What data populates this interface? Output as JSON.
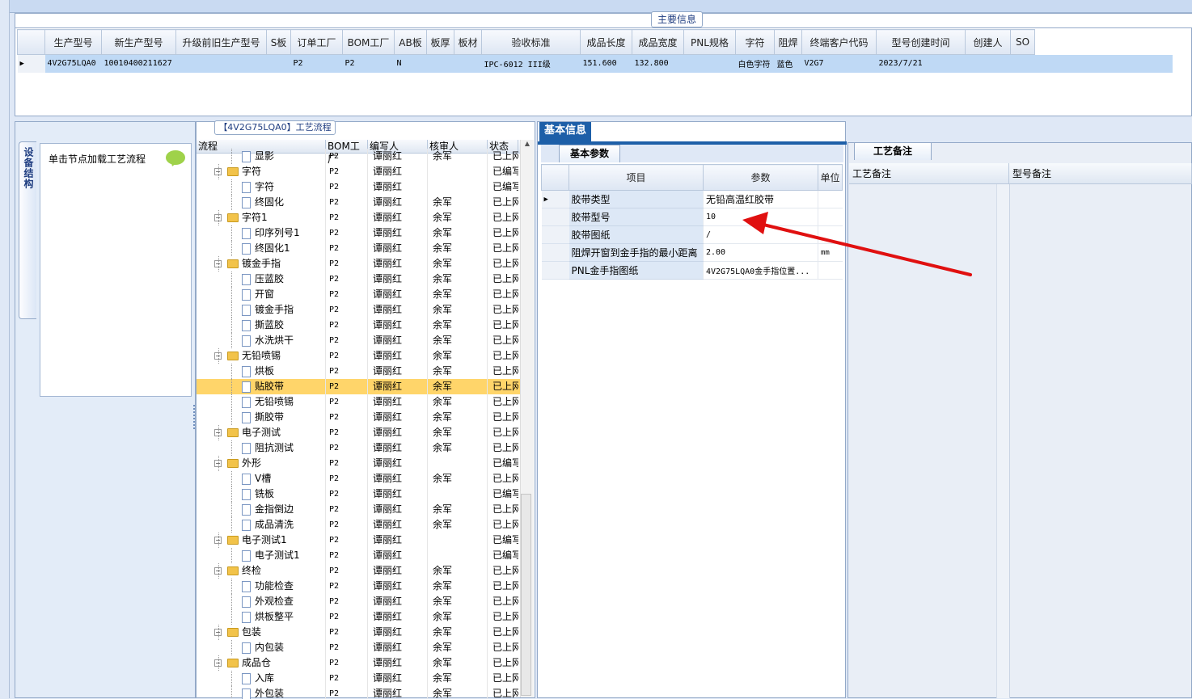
{
  "main_info": {
    "tab_label": "主要信息",
    "columns": [
      "生产型号",
      "新生产型号",
      "升级前旧生产型号",
      "S板",
      "订单工厂",
      "BOM工厂",
      "AB板",
      "板厚",
      "板材",
      "验收标准",
      "成品长度",
      "成品宽度",
      "PNL规格",
      "字符",
      "阻焊",
      "终端客户代码",
      "型号创建时间",
      "创建人",
      "SO"
    ],
    "row": [
      "4V2G75LQA0",
      "10010400211627",
      "",
      "",
      "P2",
      "P2",
      "N",
      "",
      "",
      "IPC-6012 III级",
      "151.600",
      "132.800",
      "",
      "白色字符",
      "蓝色",
      "V2G7",
      "2023/7/21",
      "",
      ""
    ]
  },
  "left_panel": {
    "vertical_tab": "设备结构",
    "box_title": "单击节点加载工艺流程",
    "bubble_icon": "speech-bubble-icon"
  },
  "tree_panel": {
    "tab_label": "【4V2G75LQA0】工艺流程",
    "headers": [
      "流程",
      "BOM工厂",
      "编写人",
      "核审人",
      "状态"
    ],
    "rows": [
      {
        "level": 1,
        "type": "doc",
        "name": "显影",
        "bom": "P2",
        "author": "谭丽红",
        "reviewer": "余军",
        "status": "已上网"
      },
      {
        "level": 0,
        "type": "folder",
        "name": "字符",
        "bom": "P2",
        "author": "谭丽红",
        "reviewer": "",
        "status": "已编写"
      },
      {
        "level": 1,
        "type": "doc",
        "name": "字符",
        "bom": "P2",
        "author": "谭丽红",
        "reviewer": "",
        "status": "已编写"
      },
      {
        "level": 1,
        "type": "doc",
        "name": "终固化",
        "bom": "P2",
        "author": "谭丽红",
        "reviewer": "余军",
        "status": "已上网"
      },
      {
        "level": 0,
        "type": "folder",
        "name": "字符1",
        "bom": "P2",
        "author": "谭丽红",
        "reviewer": "余军",
        "status": "已上网"
      },
      {
        "level": 1,
        "type": "doc",
        "name": "印序列号1",
        "bom": "P2",
        "author": "谭丽红",
        "reviewer": "余军",
        "status": "已上网"
      },
      {
        "level": 1,
        "type": "doc",
        "name": "终固化1",
        "bom": "P2",
        "author": "谭丽红",
        "reviewer": "余军",
        "status": "已上网"
      },
      {
        "level": 0,
        "type": "folder",
        "name": "镀金手指",
        "bom": "P2",
        "author": "谭丽红",
        "reviewer": "余军",
        "status": "已上网"
      },
      {
        "level": 1,
        "type": "doc",
        "name": "压蓝胶",
        "bom": "P2",
        "author": "谭丽红",
        "reviewer": "余军",
        "status": "已上网"
      },
      {
        "level": 1,
        "type": "doc",
        "name": "开窗",
        "bom": "P2",
        "author": "谭丽红",
        "reviewer": "余军",
        "status": "已上网"
      },
      {
        "level": 1,
        "type": "doc",
        "name": "镀金手指",
        "bom": "P2",
        "author": "谭丽红",
        "reviewer": "余军",
        "status": "已上网"
      },
      {
        "level": 1,
        "type": "doc",
        "name": "撕蓝胶",
        "bom": "P2",
        "author": "谭丽红",
        "reviewer": "余军",
        "status": "已上网"
      },
      {
        "level": 1,
        "type": "doc",
        "name": "水洗烘干",
        "bom": "P2",
        "author": "谭丽红",
        "reviewer": "余军",
        "status": "已上网"
      },
      {
        "level": 0,
        "type": "folder",
        "name": "无铅喷锡",
        "bom": "P2",
        "author": "谭丽红",
        "reviewer": "余军",
        "status": "已上网"
      },
      {
        "level": 1,
        "type": "doc",
        "name": "烘板",
        "bom": "P2",
        "author": "谭丽红",
        "reviewer": "余军",
        "status": "已上网"
      },
      {
        "level": 1,
        "type": "doc",
        "name": "贴胶带",
        "bom": "P2",
        "author": "谭丽红",
        "reviewer": "余军",
        "status": "已上网",
        "highlight": true
      },
      {
        "level": 1,
        "type": "doc",
        "name": "无铅喷锡",
        "bom": "P2",
        "author": "谭丽红",
        "reviewer": "余军",
        "status": "已上网"
      },
      {
        "level": 1,
        "type": "doc",
        "name": "撕胶带",
        "bom": "P2",
        "author": "谭丽红",
        "reviewer": "余军",
        "status": "已上网"
      },
      {
        "level": 0,
        "type": "folder",
        "name": "电子测试",
        "bom": "P2",
        "author": "谭丽红",
        "reviewer": "余军",
        "status": "已上网"
      },
      {
        "level": 1,
        "type": "doc",
        "name": "阻抗测试",
        "bom": "P2",
        "author": "谭丽红",
        "reviewer": "余军",
        "status": "已上网"
      },
      {
        "level": 0,
        "type": "folder",
        "name": "外形",
        "bom": "P2",
        "author": "谭丽红",
        "reviewer": "",
        "status": "已编写"
      },
      {
        "level": 1,
        "type": "doc",
        "name": "V槽",
        "bom": "P2",
        "author": "谭丽红",
        "reviewer": "余军",
        "status": "已上网"
      },
      {
        "level": 1,
        "type": "doc",
        "name": "铣板",
        "bom": "P2",
        "author": "谭丽红",
        "reviewer": "",
        "status": "已编写"
      },
      {
        "level": 1,
        "type": "doc",
        "name": "金指倒边",
        "bom": "P2",
        "author": "谭丽红",
        "reviewer": "余军",
        "status": "已上网"
      },
      {
        "level": 1,
        "type": "doc",
        "name": "成品清洗",
        "bom": "P2",
        "author": "谭丽红",
        "reviewer": "余军",
        "status": "已上网"
      },
      {
        "level": 0,
        "type": "folder",
        "name": "电子测试1",
        "bom": "P2",
        "author": "谭丽红",
        "reviewer": "",
        "status": "已编写"
      },
      {
        "level": 1,
        "type": "doc",
        "name": "电子测试1",
        "bom": "P2",
        "author": "谭丽红",
        "reviewer": "",
        "status": "已编写"
      },
      {
        "level": 0,
        "type": "folder",
        "name": "终检",
        "bom": "P2",
        "author": "谭丽红",
        "reviewer": "余军",
        "status": "已上网"
      },
      {
        "level": 1,
        "type": "doc",
        "name": "功能检查",
        "bom": "P2",
        "author": "谭丽红",
        "reviewer": "余军",
        "status": "已上网"
      },
      {
        "level": 1,
        "type": "doc",
        "name": "外观检查",
        "bom": "P2",
        "author": "谭丽红",
        "reviewer": "余军",
        "status": "已上网"
      },
      {
        "level": 1,
        "type": "doc",
        "name": "烘板整平",
        "bom": "P2",
        "author": "谭丽红",
        "reviewer": "余军",
        "status": "已上网"
      },
      {
        "level": 0,
        "type": "folder",
        "name": "包装",
        "bom": "P2",
        "author": "谭丽红",
        "reviewer": "余军",
        "status": "已上网"
      },
      {
        "level": 1,
        "type": "doc",
        "name": "内包装",
        "bom": "P2",
        "author": "谭丽红",
        "reviewer": "余军",
        "status": "已上网"
      },
      {
        "level": 0,
        "type": "folder",
        "name": "成品仓",
        "bom": "P2",
        "author": "谭丽红",
        "reviewer": "余军",
        "status": "已上网"
      },
      {
        "level": 1,
        "type": "doc",
        "name": "入库",
        "bom": "P2",
        "author": "谭丽红",
        "reviewer": "余军",
        "status": "已上网"
      },
      {
        "level": 1,
        "type": "doc",
        "name": "外包装",
        "bom": "P2",
        "author": "谭丽红",
        "reviewer": "余军",
        "status": "已上网"
      }
    ]
  },
  "basic_info": {
    "tab_label": "基本信息",
    "sub_tab": "基本参数",
    "headers": [
      "项目",
      "参数",
      "单位"
    ],
    "rows": [
      {
        "item": "胶带类型",
        "value": "无铅高温红胶带",
        "unit": ""
      },
      {
        "item": "胶带型号",
        "value": "10",
        "unit": ""
      },
      {
        "item": "胶带图纸",
        "value": "/",
        "unit": ""
      },
      {
        "item": "阻焊开窗到金手指的最小距离",
        "value": "2.00",
        "unit": "mm"
      },
      {
        "item": "PNL金手指图纸",
        "value": "4V2G75LQA0金手指位置...",
        "unit": ""
      }
    ]
  },
  "remarks": {
    "tab_label": "工艺备注",
    "col1": "工艺备注",
    "col2": "型号备注"
  },
  "annotation": {
    "arrow_color": "#e01010"
  }
}
